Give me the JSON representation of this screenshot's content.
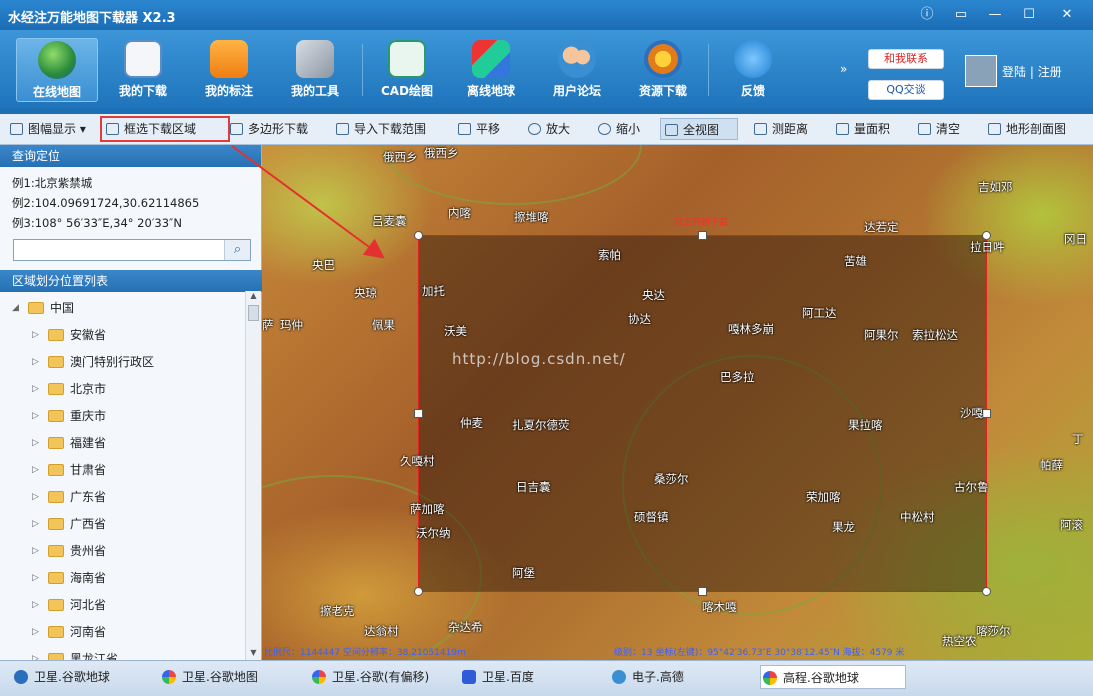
{
  "window": {
    "title": "水经注万能地图下载器 X2.3"
  },
  "mainbar": {
    "buttons": [
      {
        "label": "在线地图",
        "icon": "globe-icon"
      },
      {
        "label": "我的下载",
        "icon": "download-list-icon"
      },
      {
        "label": "我的标注",
        "icon": "map-pin-icon"
      },
      {
        "label": "我的工具",
        "icon": "tools-icon"
      },
      {
        "label": "CAD绘图",
        "icon": "cad-icon"
      },
      {
        "label": "离线地球",
        "icon": "cubes-icon"
      },
      {
        "label": "用户论坛",
        "icon": "users-icon"
      },
      {
        "label": "资源下载",
        "icon": "resource-icon"
      },
      {
        "label": "反馈",
        "icon": "info-icon"
      }
    ],
    "contact_label": "和我联系",
    "qq_label": "QQ交谈",
    "login_label": "登陆",
    "divider": "|",
    "register_label": "注册",
    "more": "»"
  },
  "subbar": {
    "buttons": [
      "图幅显示",
      "框选下载区域",
      "多边形下载",
      "导入下载范围",
      "平移",
      "放大",
      "缩小",
      "全视图",
      "测距离",
      "量面积",
      "清空",
      "地形剖面图"
    ]
  },
  "left": {
    "query_title": "查询定位",
    "examples": [
      "例1:北京紫禁城",
      "例2:104.09691724,30.62114865",
      "例3:108° 56′33″E,34° 20′33″N"
    ],
    "search_value": "",
    "region_title": "区域划分位置列表",
    "tree_root": "中国",
    "tree_items": [
      "安徽省",
      "澳门特别行政区",
      "北京市",
      "重庆市",
      "福建省",
      "甘肃省",
      "广东省",
      "广西省",
      "贵州省",
      "海南省",
      "河北省",
      "河南省",
      "黑龙江省"
    ]
  },
  "map": {
    "hint": "双击开始下载",
    "watermark": "http://blog.csdn.net/",
    "places": [
      "俄西乡",
      "俄西乡",
      "吉如邓",
      "吕麦囊",
      "内喀",
      "擦堆喀",
      "达若定",
      "拉日吽",
      "冈日",
      "央巴",
      "索帕",
      "苦雄",
      "央琼",
      "加托",
      "央达",
      "协达",
      "阿工达",
      "萨",
      "玛仲",
      "佩果",
      "沃美",
      "嘎林多崩",
      "阿果尔",
      "索拉松达",
      "巴多拉",
      "仲麦",
      "扎夏尔德荧",
      "果拉喀",
      "沙嘎",
      "丁",
      "久嘎村",
      "帕薛",
      "桑莎尔",
      "日吉囊",
      "古尔鲁",
      "萨加喀",
      "荣加喀",
      "沃尔纳",
      "硕督镇",
      "果龙",
      "中松村",
      "阿滚",
      "阿堡",
      "喀木嘎",
      "擦老克",
      "达翁村",
      "杂达希",
      "热空农",
      "喀莎尔"
    ],
    "status_left": "比例尺：1144447   空间分辨率：38.21051419m",
    "status_right": "级别：13  坐标(左键)：95°42′36.73″E  30°38′12.45″N 海拔：4579 米"
  },
  "tabs": [
    "卫星.谷歌地球",
    "卫星.谷歌地图",
    "卫星.谷歌(有偏移)",
    "卫星.百度",
    "电子.高德",
    "高程.谷歌地球"
  ]
}
